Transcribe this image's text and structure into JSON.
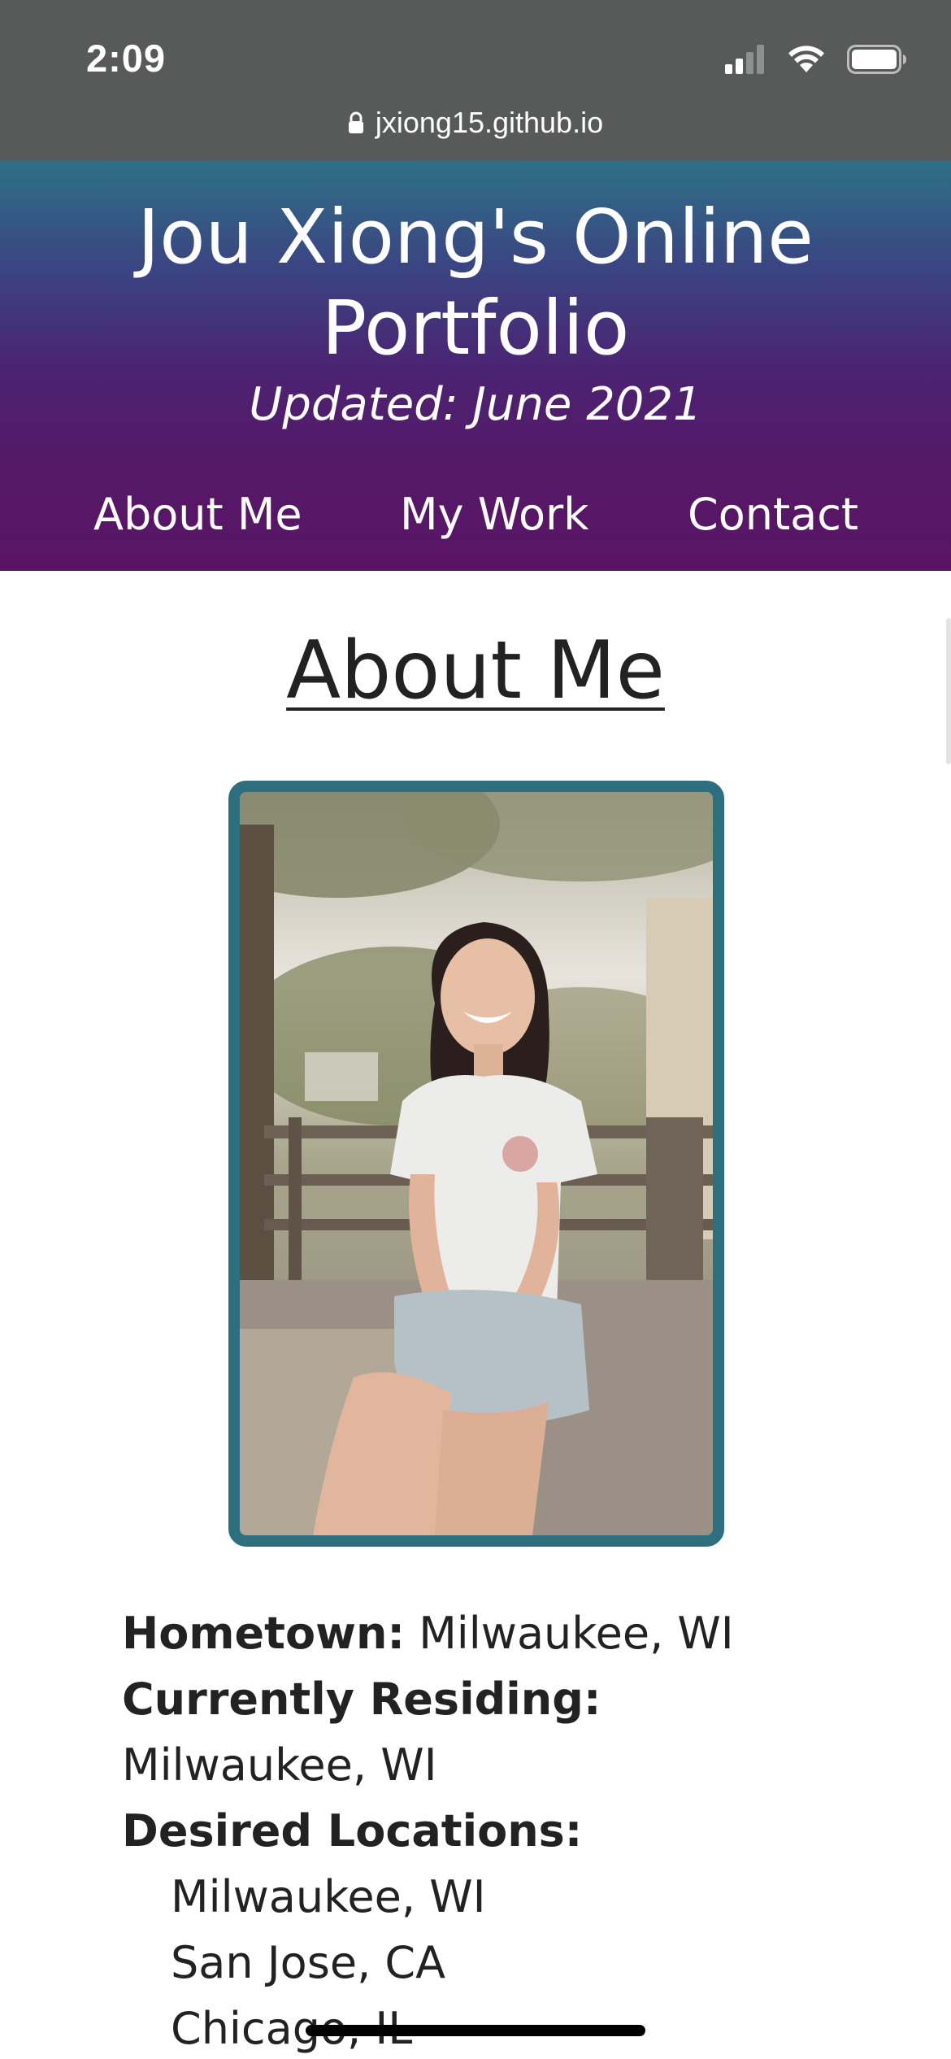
{
  "status_bar": {
    "time": "2:09"
  },
  "browser": {
    "url": "jxiong15.github.io"
  },
  "header": {
    "title": "Jou Xiong's Online Portfolio",
    "updated": "Updated: June 2021",
    "nav": [
      {
        "label": "About Me"
      },
      {
        "label": "My Work"
      },
      {
        "label": "Contact"
      }
    ]
  },
  "about": {
    "heading": "About Me",
    "hometown_label": "Hometown:",
    "hometown_value": "Milwaukee, WI",
    "residing_label": "Currently Residing:",
    "residing_value": "Milwaukee, WI",
    "desired_label": "Desired Locations:",
    "desired_locations": [
      "Milwaukee, WI",
      "San Jose, CA",
      "Chicago, IL"
    ]
  },
  "icons": {
    "signal": "cellular-signal-icon",
    "wifi": "wifi-icon",
    "battery": "battery-icon",
    "lock": "lock-icon"
  },
  "colors": {
    "frame_border": "#2e6f7f",
    "header_top": "#2e7084",
    "header_bottom": "#5a1466",
    "browser_bar": "#575a58"
  }
}
